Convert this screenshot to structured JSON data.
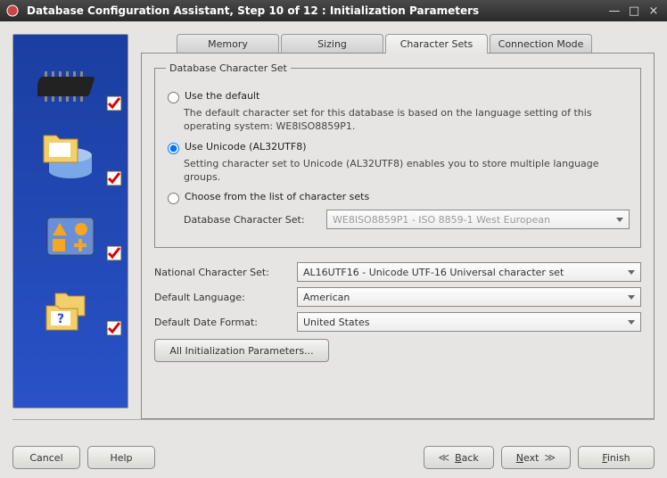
{
  "window": {
    "title": "Database Configuration Assistant, Step 10 of 12 : Initialization Parameters"
  },
  "tabs": {
    "memory": "Memory",
    "sizing": "Sizing",
    "charsets": "Character Sets",
    "connmode": "Connection Mode"
  },
  "dcs": {
    "legend": "Database Character Set",
    "opt_default": "Use the default",
    "opt_default_desc": "The default character set for this database is based on the language setting of this operating system: WE8ISO8859P1.",
    "opt_unicode": "Use Unicode (AL32UTF8)",
    "opt_unicode_desc": "Setting character set to Unicode (AL32UTF8) enables you to store multiple language groups.",
    "opt_choose": "Choose from the list of character sets",
    "dbcharset_label": "Database Character Set:",
    "dbcharset_value": "WE8ISO8859P1 - ISO 8859-1 West European"
  },
  "rows": {
    "ncs_label": "National Character Set:",
    "ncs_value": "AL16UTF16 - Unicode UTF-16 Universal character set",
    "lang_label": "Default Language:",
    "lang_value": "American",
    "date_label": "Default Date Format:",
    "date_value": "United States"
  },
  "all_init": "All Initialization Parameters...",
  "buttons": {
    "cancel": "Cancel",
    "help": "Help",
    "back_u": "B",
    "back_rest": "ack",
    "next_u": "N",
    "next_rest": "ext",
    "finish_u": "F",
    "finish_rest": "inish"
  }
}
